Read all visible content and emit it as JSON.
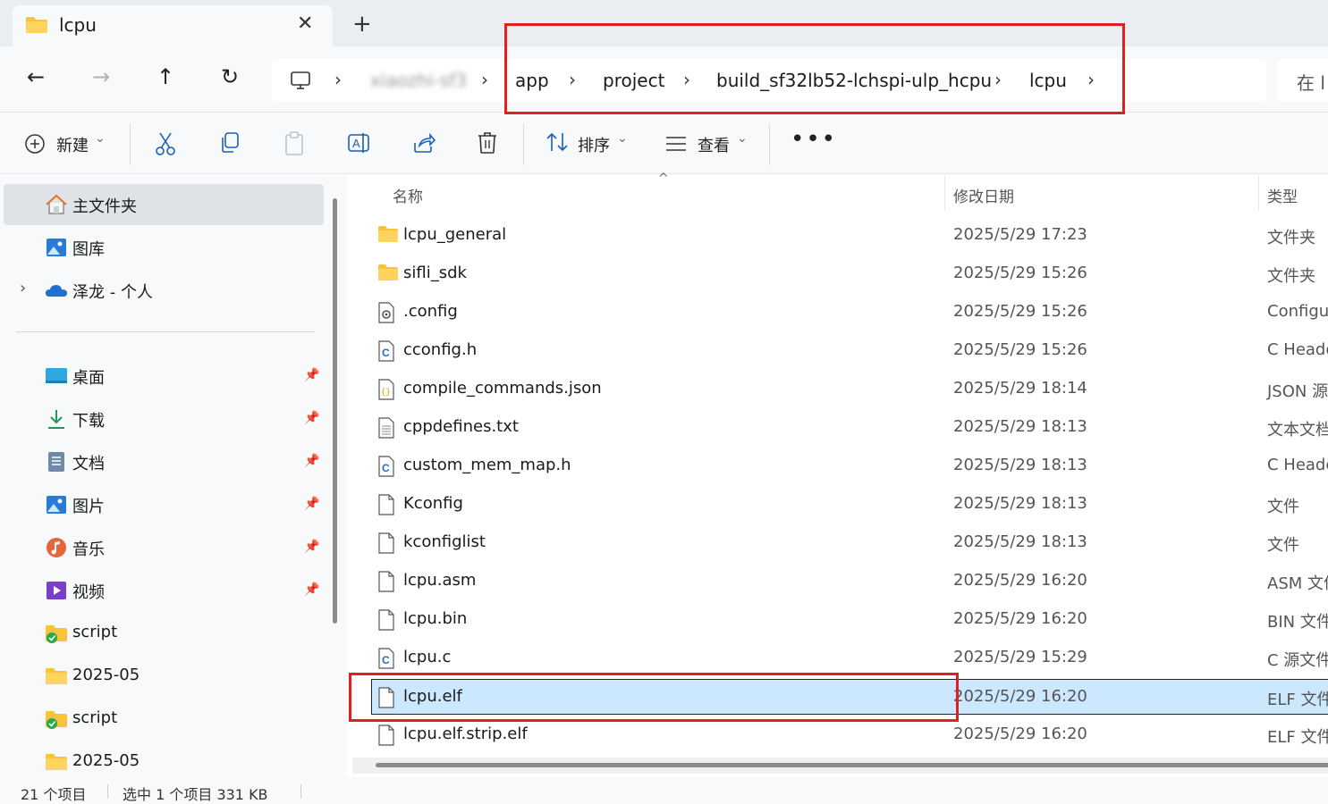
{
  "tab": {
    "title": "lcpu",
    "close": "✕",
    "new_tab": "+"
  },
  "nav": {
    "back": "←",
    "forward": "→",
    "up": "↑",
    "refresh": "↻",
    "sep": "›",
    "breadcrumbs": [
      "app",
      "project",
      "build_sf32lb52-lchspi-ulp_hcpu",
      "lcpu"
    ],
    "blurred_crumb": "xiaozhi-sf3",
    "search_placeholder": "在 l"
  },
  "toolbar": {
    "new_label": "新建",
    "sort_label": "排序",
    "view_label": "查看",
    "dropdown": "⌄",
    "more": "•••"
  },
  "sidebar": {
    "top": [
      {
        "label": "主文件夹",
        "icon": "home-icon"
      },
      {
        "label": "图库",
        "icon": "gallery-icon"
      },
      {
        "label": "泽龙 - 个人",
        "icon": "onedrive-cloud-icon",
        "expander": "›"
      }
    ],
    "pinned": [
      {
        "label": "桌面",
        "icon": "desktop-icon"
      },
      {
        "label": "下载",
        "icon": "download-icon"
      },
      {
        "label": "文档",
        "icon": "documents-icon"
      },
      {
        "label": "图片",
        "icon": "pictures-icon"
      },
      {
        "label": "音乐",
        "icon": "music-icon"
      },
      {
        "label": "视频",
        "icon": "video-icon"
      }
    ],
    "recent": [
      {
        "label": "script",
        "icon": "synced-folder-icon"
      },
      {
        "label": "2025-05",
        "icon": "folder-icon"
      },
      {
        "label": "script",
        "icon": "synced-folder-icon"
      },
      {
        "label": "2025-05",
        "icon": "folder-icon"
      }
    ],
    "pin_glyph": "📌"
  },
  "columns": {
    "name": "名称",
    "modified": "修改日期",
    "type": "类型"
  },
  "files": [
    {
      "name": "lcpu_general",
      "date": "2025/5/29 17:23",
      "type": "文件夹",
      "icon": "folder"
    },
    {
      "name": "sifli_sdk",
      "date": "2025/5/29 15:26",
      "type": "文件夹",
      "icon": "folder"
    },
    {
      "name": ".config",
      "date": "2025/5/29 15:26",
      "type": "Configu",
      "icon": "config"
    },
    {
      "name": "cconfig.h",
      "date": "2025/5/29 15:26",
      "type": "C Heade",
      "icon": "c"
    },
    {
      "name": "compile_commands.json",
      "date": "2025/5/29 18:14",
      "type": "JSON 源",
      "icon": "json"
    },
    {
      "name": "cppdefines.txt",
      "date": "2025/5/29 18:13",
      "type": "文本文档",
      "icon": "txt"
    },
    {
      "name": "custom_mem_map.h",
      "date": "2025/5/29 18:13",
      "type": "C Heade",
      "icon": "c"
    },
    {
      "name": "Kconfig",
      "date": "2025/5/29 18:13",
      "type": "文件",
      "icon": "file"
    },
    {
      "name": "kconfiglist",
      "date": "2025/5/29 18:13",
      "type": "文件",
      "icon": "file"
    },
    {
      "name": "lcpu.asm",
      "date": "2025/5/29 16:20",
      "type": "ASM 文件",
      "icon": "file"
    },
    {
      "name": "lcpu.bin",
      "date": "2025/5/29 16:20",
      "type": "BIN 文件",
      "icon": "file"
    },
    {
      "name": "lcpu.c",
      "date": "2025/5/29 15:29",
      "type": "C 源文件",
      "icon": "c"
    },
    {
      "name": "lcpu.elf",
      "date": "2025/5/29 16:20",
      "type": "ELF 文件",
      "icon": "file",
      "selected": true
    },
    {
      "name": "lcpu.elf.strip.elf",
      "date": "2025/5/29 16:20",
      "type": "ELF 文件",
      "icon": "file"
    }
  ],
  "status": {
    "count": "21 个项目",
    "selection": "选中 1 个项目  331 KB"
  },
  "colors": {
    "accent": "#0067c0",
    "selection": "#cce8ff",
    "annotation": "#e02020",
    "folder": "#f8c33a"
  }
}
